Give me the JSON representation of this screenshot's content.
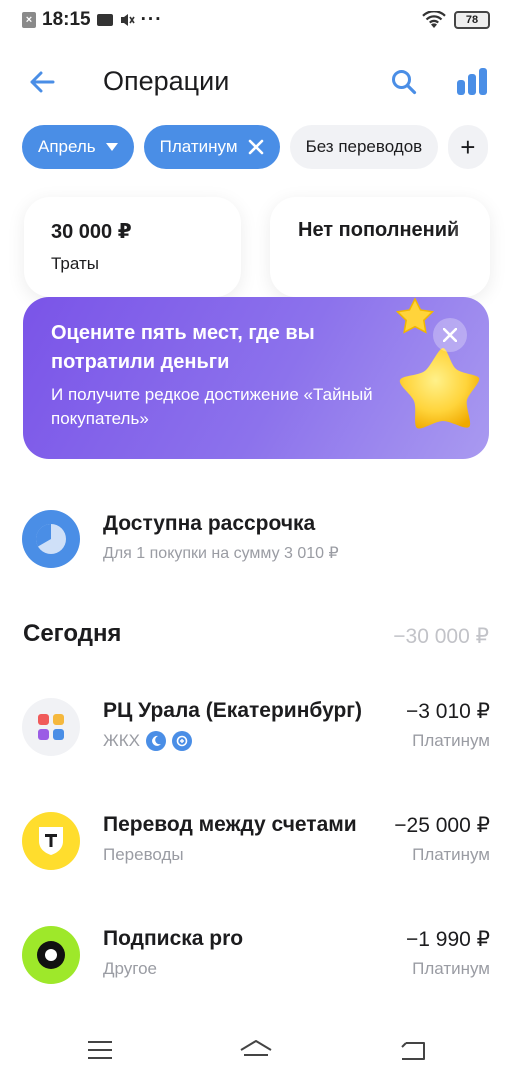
{
  "status_bar": {
    "time": "18:15",
    "notification_box": "×",
    "dots": "···",
    "battery": "78"
  },
  "header": {
    "title": "Операции"
  },
  "chips": [
    {
      "label": "Апрель",
      "icon": "chevron-down-icon",
      "active": true
    },
    {
      "label": "Платинум",
      "icon": "close-icon",
      "active": true
    },
    {
      "label": "Без переводов",
      "active": false
    },
    {
      "label": "+",
      "active": false
    }
  ],
  "summary": {
    "spend": {
      "amount": "30 000 ₽",
      "label": "Траты"
    },
    "income": {
      "amount": "Нет пополнений"
    }
  },
  "promo": {
    "title": "Оцените пять мест, где вы потратили деньги",
    "text": "И получите редкое достижение «Тайный покупатель»",
    "colors": {
      "start": "#7a54e8",
      "end": "#a99af0",
      "star": "#ffd43b"
    }
  },
  "installment": {
    "title": "Доступна рассрочка",
    "subtitle": "Для 1 покупки на сумму 3 010 ₽"
  },
  "section": {
    "title": "Сегодня",
    "total": "−30 000 ₽"
  },
  "transactions": [
    {
      "name": "РЦ Урала (Екатеринбург)",
      "category": "ЖКХ",
      "amount": "−3 010 ₽",
      "account": "Платинум",
      "icon": "utility-logo-icon",
      "icon_bg": "#f1f2f5"
    },
    {
      "name": "Перевод между счетами",
      "category": "Переводы",
      "amount": "−25 000 ₽",
      "account": "Платинум",
      "icon": "tinkoff-shield-icon",
      "icon_bg": "#ffdd2d"
    },
    {
      "name": "Подписка pro",
      "category": "Другое",
      "amount": "−1 990 ₽",
      "account": "Платинум",
      "icon": "pro-ring-icon",
      "icon_bg": "#9ee82a"
    }
  ],
  "accent_color": "#4a8ee6"
}
